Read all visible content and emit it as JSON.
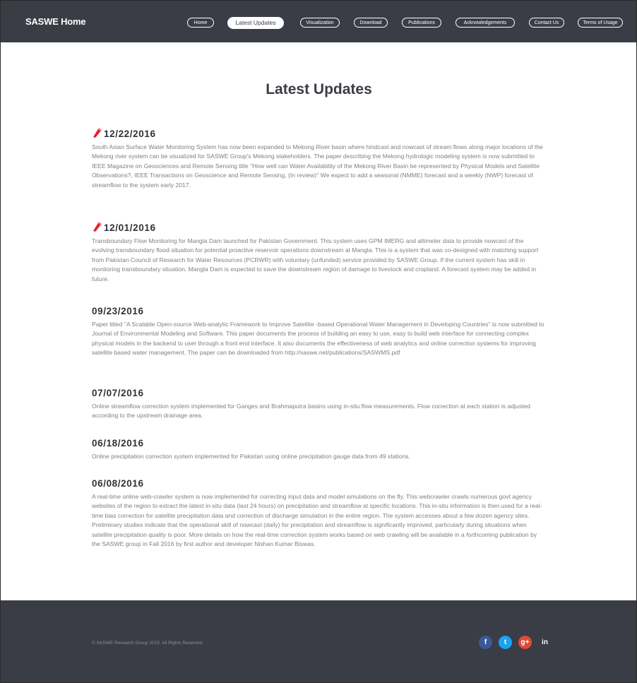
{
  "navbar": {
    "brand": "SASWE Home",
    "items": [
      {
        "label": "Home",
        "active": false
      },
      {
        "label": "Latest Updates",
        "active": true
      },
      {
        "label": "Visualization",
        "active": false
      },
      {
        "label": "Download",
        "active": false
      },
      {
        "label": "Publications",
        "active": false
      },
      {
        "label": "Acknowledgements",
        "active": false
      },
      {
        "label": "Contact Us",
        "active": false
      },
      {
        "label": "Terms of Usage",
        "active": false
      }
    ]
  },
  "main": {
    "title": "Latest Updates",
    "updates": [
      {
        "date": "12/22/2016",
        "is_new": true,
        "text": "South Asian Surface Water Monitoring System has now been expanded to Mekong River basin where hindcast and nowcast of stream flows along major locations of the Mekong river system can be visualized for SASWE Group's Mekong stakeholders. The paper describing the Mekong hydrologic modeling system is now submitted to IEEE Magazine on Geosciences and Remote Sensing title \"How well can Water Availability of the Mekong River Basin be represented by Physical Models and Satellite Observations?, IEEE Transactions on Geoscience and Remote Sensing, (In review)\" We expect to add a seasonal (NMME) forecast and a weekly (NWP) forecast of streamflow to the system early 2017."
      },
      {
        "date": "12/01/2016",
        "is_new": true,
        "text": "Transboundary Flow Monitoring for Mangla Dam launched for Pakistan Government. This system uses GPM IMERG and altimeter data to provide nowcast of the evolving transboundary flood situation for potential proactive reservoir operations downstream at Mangla. This is a system that was co-designed with matching support from Pakistan Council of Research for Water Resources (PCRWR) with voluntary (unfunded) service provided by SASWE Group. If the current system has skill in monitoring transboundary situation, Mangla Dam is expected to save the downstream region of damage to livestock and cropland. A forecast system may be added in future."
      },
      {
        "date": "09/23/2016",
        "is_new": false,
        "text": "Paper titled \"A Scalable Open-source Web-analytic Framework to Improve Satellite -based Operational Water Management in Developing Countries\" is now submitted to Journal of Environmental Modeling and Software. This paper documents the process of building an easy to use, easy to build web interface for connecting complex physical models in the backend to user through a front end interface. It also documents the effectiveness of web analytics and online correction systems for improving satellite based water management. The paper can be downloaded from http://saswe.net/publications/SASWMS.pdf"
      },
      {
        "date": "07/07/2016",
        "is_new": false,
        "text": "Online streamflow correction system implemented for Ganges and Brahmaputra basins using in-situ flow measurements. Flow correction at each station is adjusted according to the upstream drainage area."
      },
      {
        "date": "06/18/2016",
        "is_new": false,
        "text": "Online precipitation correction system implemented for Pakistan using online precipitation gauge data from 49 stations."
      },
      {
        "date": "06/08/2016",
        "is_new": false,
        "text": "A real-time online web-crawler system is now implemented for correcting input data and model simulations on the fly. This webcrawler crawls numerous govt agency websites of the region to extract the latest in-situ data (last 24 hours) on precipitation and streamflow at specific locations. This in-situ information is then used for a real-time bias correction for satellite precipitation data and correction of discharge simulation in the entire region. The system accesses about a few dozen agency sites. Preliminary studies indicate that the operational skill of nowcast (daily) for precipitation and streamflow is significantly improved, particularly during situations when satellite precipitation quality is poor. More details on how the real-time correction system works based on web crawling will be available in a forthcoming publication by the SASWE group in Fall 2016 by first author and developer Nishan Kumar Biswas."
      }
    ]
  },
  "footer": {
    "copyright": "© SASWE Research Group 2015. All Rights Reserved.",
    "socials": [
      {
        "icon": "facebook-icon",
        "glyph": "f",
        "color": "#3b5998"
      },
      {
        "icon": "twitter-icon",
        "glyph": "t",
        "color": "#1da1f2"
      },
      {
        "icon": "google-plus-icon",
        "glyph": "g+",
        "color": "#dd4b39"
      },
      {
        "icon": "linkedin-icon",
        "glyph": "in",
        "color": "#3a3d45"
      }
    ]
  }
}
